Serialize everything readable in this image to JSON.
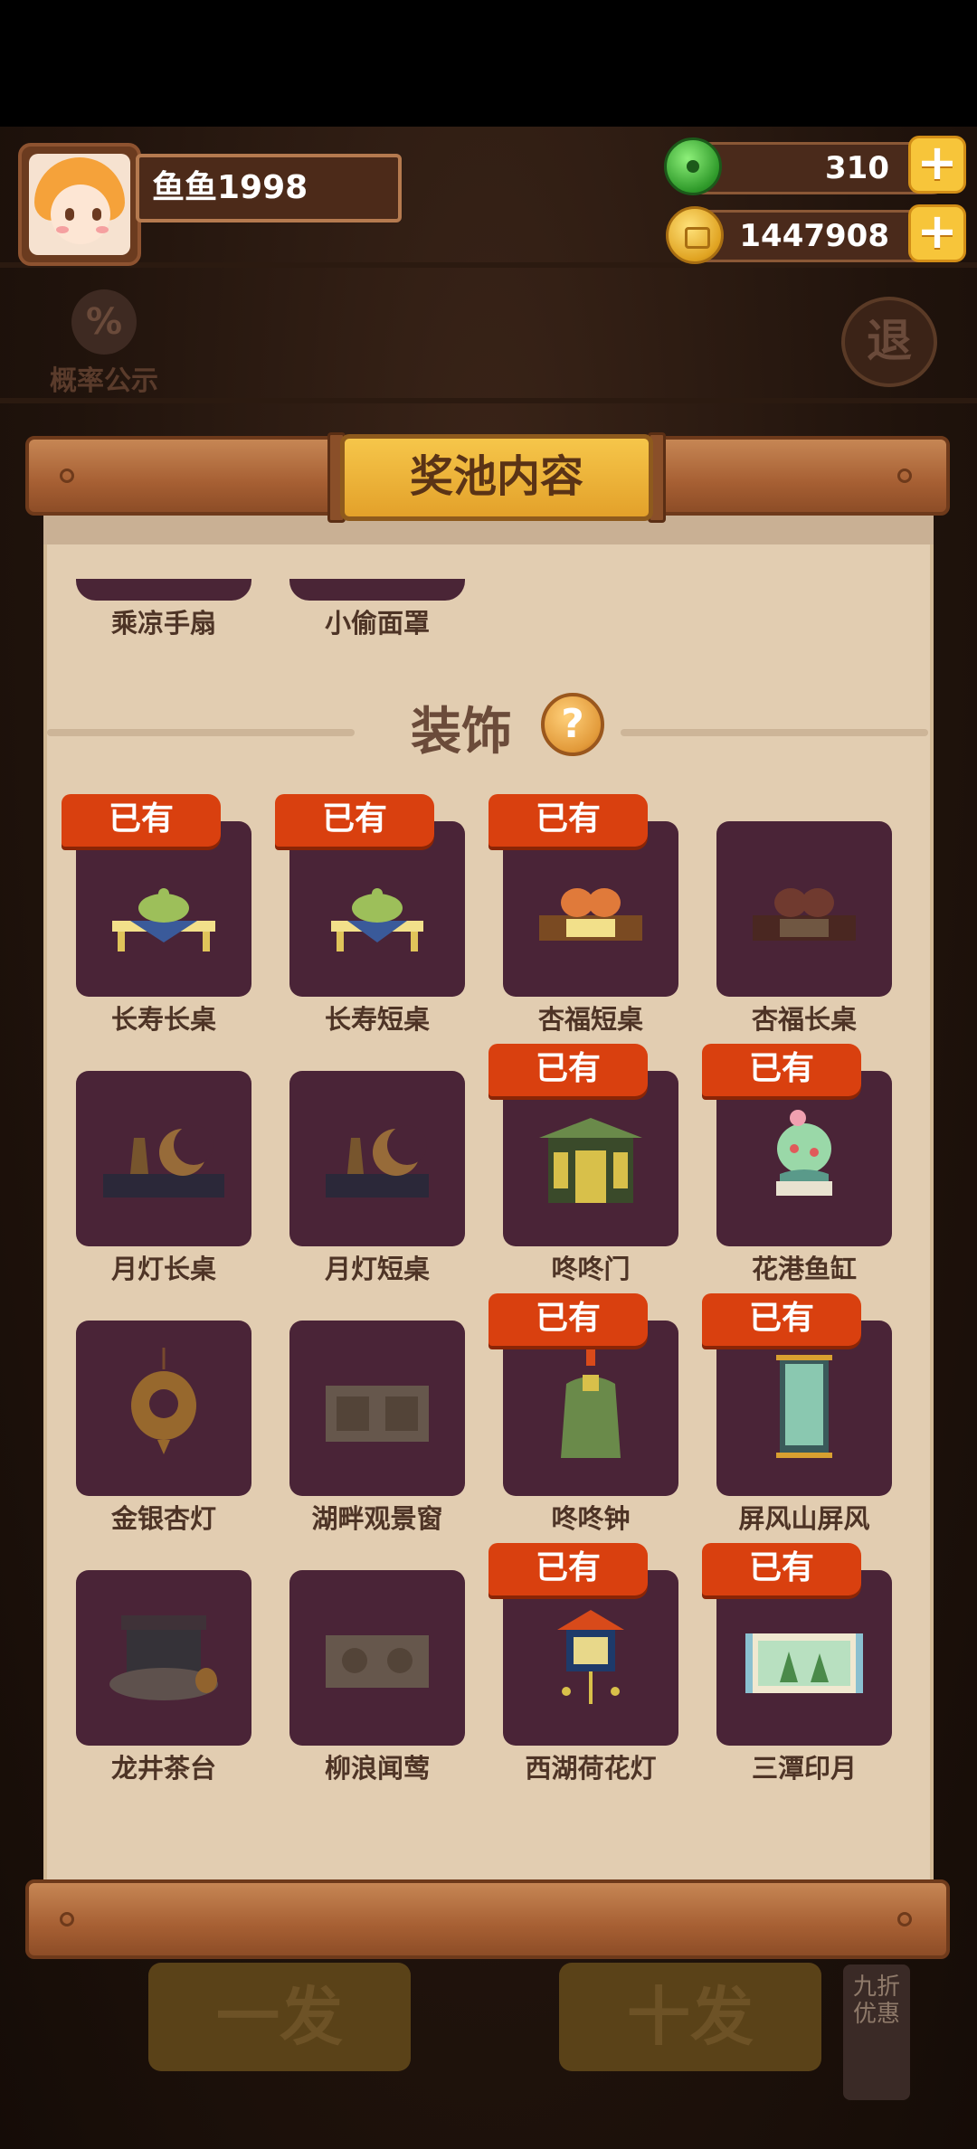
{
  "user": {
    "name": "鱼鱼1998"
  },
  "currency": {
    "jade": "310",
    "coins": "1447908"
  },
  "background": {
    "probability_label": "概率公示",
    "exit_label": "退",
    "draw_one": "一发",
    "draw_ten": "十发",
    "discount": "九折优惠"
  },
  "panel": {
    "title": "奖池内容",
    "prev_items": [
      "乘凉手扇",
      "小偷面罩"
    ],
    "section_title": "装饰",
    "help_label": "?",
    "owned_label": "已有",
    "items": [
      {
        "name": "长寿长桌",
        "owned": true
      },
      {
        "name": "长寿短桌",
        "owned": true
      },
      {
        "name": "杏福短桌",
        "owned": true
      },
      {
        "name": "杏福长桌",
        "owned": false
      },
      {
        "name": "月灯长桌",
        "owned": false
      },
      {
        "name": "月灯短桌",
        "owned": false
      },
      {
        "name": "咚咚门",
        "owned": true
      },
      {
        "name": "花港鱼缸",
        "owned": true
      },
      {
        "name": "金银杏灯",
        "owned": false
      },
      {
        "name": "湖畔观景窗",
        "owned": false
      },
      {
        "name": "咚咚钟",
        "owned": true
      },
      {
        "name": "屏风山屏风",
        "owned": true
      },
      {
        "name": "龙井茶台",
        "owned": false
      },
      {
        "name": "柳浪闻莺",
        "owned": false
      },
      {
        "name": "西湖荷花灯",
        "owned": true
      },
      {
        "name": "三潭印月",
        "owned": true
      }
    ]
  }
}
